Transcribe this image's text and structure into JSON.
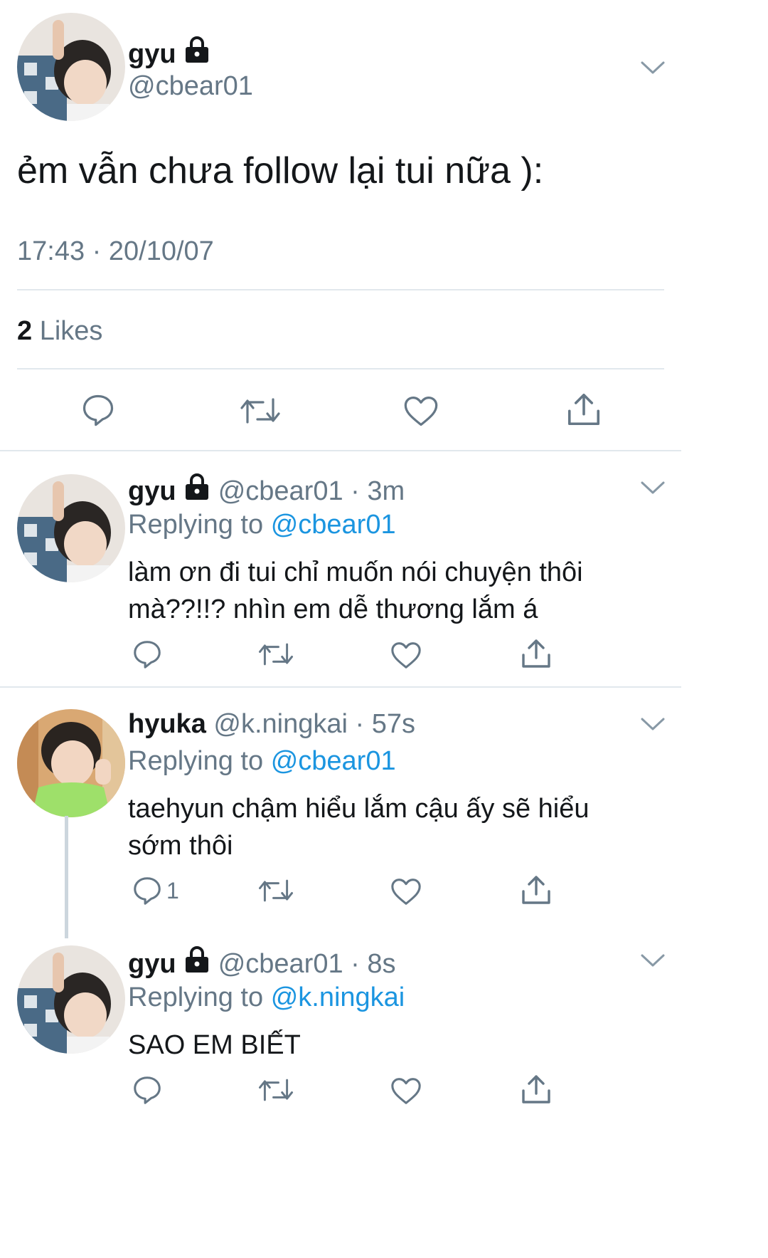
{
  "main_tweet": {
    "name": "gyu",
    "handle": "@cbear01",
    "text": "ẻm vẫn chưa follow lại tui nữa ):",
    "timestamp": "17:43 · 20/10/07",
    "likes_count": "2",
    "likes_label": "Likes"
  },
  "replies": [
    {
      "name": "gyu",
      "handle": "@cbear01",
      "time": "· 3m",
      "replying_prefix": "Replying to",
      "replying_to": "@cbear01",
      "text_line1": "làm ơn đi tui chỉ muốn nói chuyện thôi",
      "text_line2": "mà??!!? nhìn em dễ thương lắm á"
    },
    {
      "name": "hyuka",
      "handle": "@k.ningkai",
      "time": "· 57s",
      "replying_prefix": "Replying to",
      "replying_to": "@cbear01",
      "text_line1": "taehyun chậm hiểu lắm cậu ấy sẽ hiểu",
      "text_line2": "sớm thôi",
      "reply_count": "1"
    },
    {
      "name": "gyu",
      "handle": "@cbear01",
      "time": "· 8s",
      "replying_prefix": "Replying to",
      "replying_to": "@k.ningkai",
      "text_line1": "SAO EM BIẾT"
    }
  ],
  "colors": {
    "text": "#14171a",
    "muted": "#657786",
    "link": "#1b95e0",
    "divider": "#e1e8ed"
  }
}
